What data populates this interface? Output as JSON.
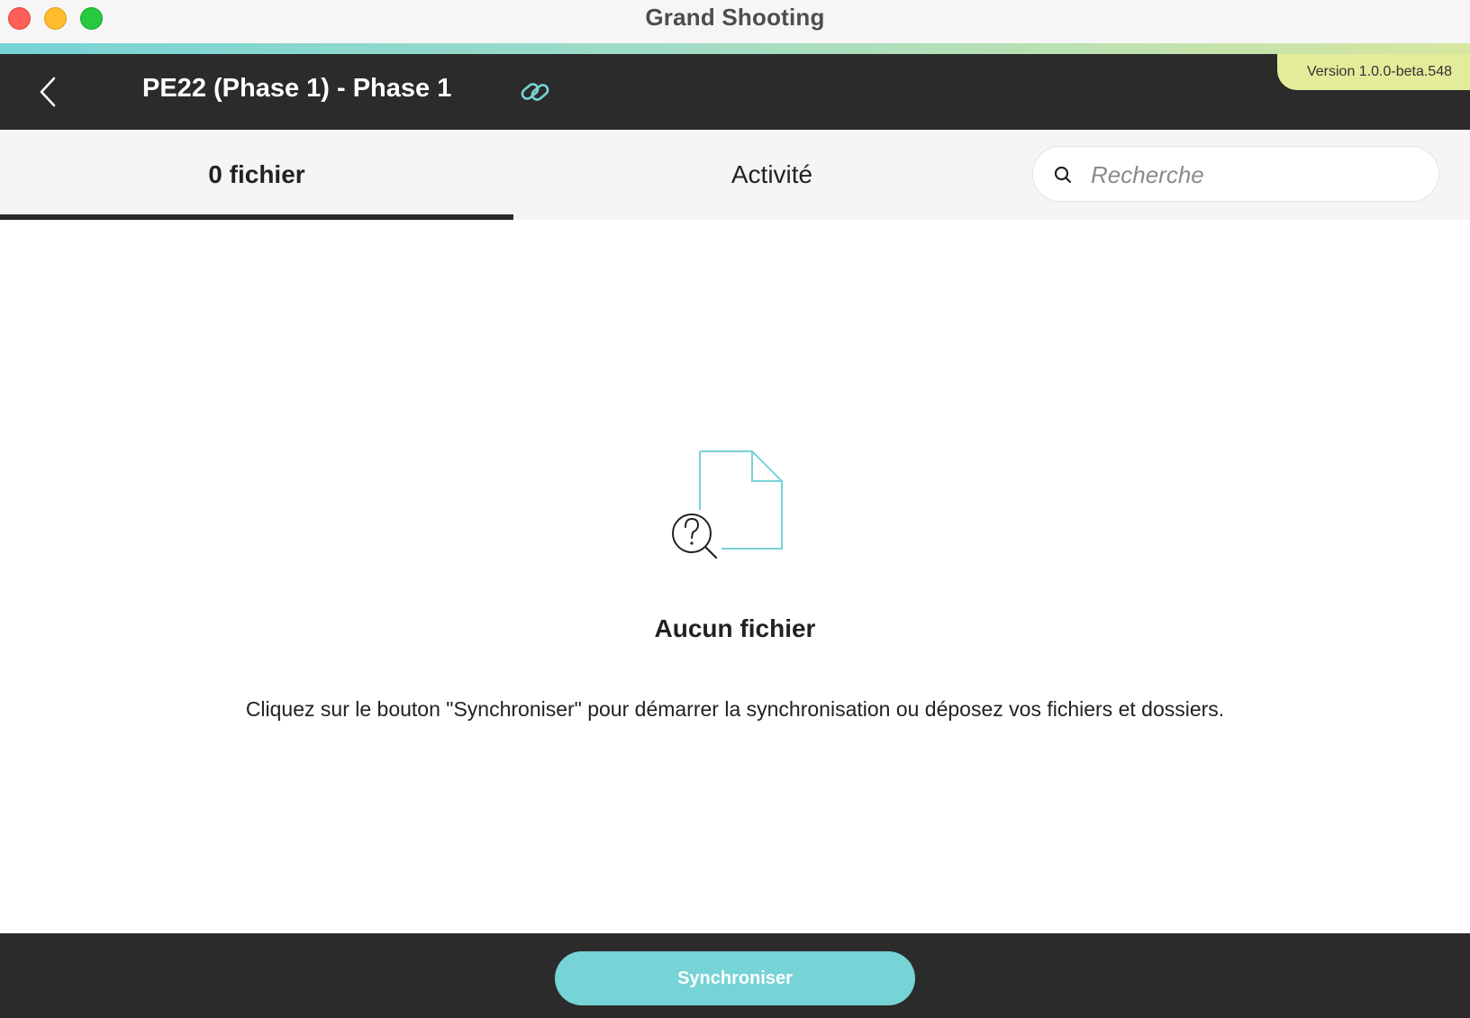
{
  "window": {
    "title": "Grand Shooting"
  },
  "header": {
    "title": "PE22 (Phase 1) - Phase 1",
    "version": "Version 1.0.0-beta.548",
    "back_icon": "chevron-left-icon",
    "link_icon": "link-icon"
  },
  "tabs": [
    {
      "label": "0 fichier",
      "active": true
    },
    {
      "label": "Activité",
      "active": false
    }
  ],
  "search": {
    "placeholder": "Recherche",
    "value": ""
  },
  "empty_state": {
    "icon": "file-search-icon",
    "title": "Aucun fichier",
    "description": "Cliquez sur le bouton \"Synchroniser\" pour démarrer la synchronisation ou déposez vos fichiers et dossiers."
  },
  "footer": {
    "sync_label": "Synchroniser"
  },
  "colors": {
    "accent": "#76d3d6",
    "header_bg": "#2b2b2b",
    "version_badge": "#e3ec9a"
  }
}
